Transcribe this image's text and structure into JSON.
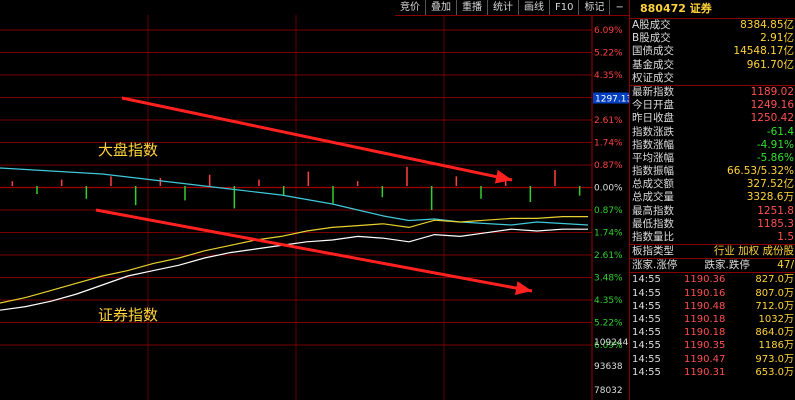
{
  "toolbar": {
    "items": [
      "竞价",
      "叠加",
      "重播",
      "统计",
      "画线",
      "F10",
      "标记",
      "−",
      "⊟"
    ]
  },
  "panel": {
    "code_title": "880472 证券",
    "stats": [
      {
        "label": "A股成交",
        "value": "8384.85亿"
      },
      {
        "label": "B股成交",
        "value": "2.91亿"
      },
      {
        "label": "国债成交",
        "value": "14548.17亿"
      },
      {
        "label": "基金成交",
        "value": "961.70亿"
      },
      {
        "label": "权证成交",
        "value": ""
      }
    ],
    "index_stats": [
      {
        "label": "最新指数",
        "value": "1189.02"
      },
      {
        "label": "今日开盘",
        "value": "1249.16"
      },
      {
        "label": "昨日收盘",
        "value": "1250.42"
      },
      {
        "label": "指数涨跌",
        "value": "-61.4"
      },
      {
        "label": "指数涨幅",
        "value": "-4.91%"
      },
      {
        "label": "平均涨幅",
        "value": "-5.86%"
      },
      {
        "label": "指数振幅",
        "value": "66.53/5.32%"
      },
      {
        "label": "总成交额",
        "value": "327.52亿"
      },
      {
        "label": "总成交量",
        "value": "3328.6万"
      },
      {
        "label": "最高指数",
        "value": "1251.8"
      },
      {
        "label": "最低指数",
        "value": "1185.3"
      },
      {
        "label": "指数量比",
        "value": "1.5"
      }
    ],
    "board": {
      "label": "板指类型",
      "value": "行业 加权 成份股"
    },
    "trade_header": {
      "left": "涨家.涨停",
      "mid": "跌家.跌停",
      "right": "47/"
    },
    "trades": [
      {
        "time": "14:55",
        "price": "1190.36",
        "vol": "827.0万"
      },
      {
        "time": "14:55",
        "price": "1190.16",
        "vol": "807.0万"
      },
      {
        "time": "14:55",
        "price": "1190.48",
        "vol": "712.0万"
      },
      {
        "time": "14:55",
        "price": "1190.18",
        "vol": "1032万"
      },
      {
        "time": "14:55",
        "price": "1190.18",
        "vol": "864.0万"
      },
      {
        "time": "14:55",
        "price": "1190.35",
        "vol": "1186万"
      },
      {
        "time": "14:55",
        "price": "1190.47",
        "vol": "973.0万"
      },
      {
        "time": "14:55",
        "price": "1190.31",
        "vol": "653.0万"
      }
    ]
  },
  "colors": {
    "grid": "#a00000",
    "white_line": "#ffffff",
    "yellow_line": "#e8d030",
    "upper_blue_line": "#40c8d8",
    "bar_up": "#ff4040",
    "bar_down": "#30d030",
    "arrow": "#ff2020",
    "annotation": "#ffd33a",
    "zero_label_bg": "#0040c0"
  },
  "chart_data": [
    {
      "type": "line",
      "title": "",
      "annotation": "大盘指数",
      "series": [
        {
          "values": [
            0.6,
            0.55,
            0.5,
            0.45,
            0.4,
            0.3,
            0.2,
            0.1,
            0.0,
            -0.1,
            -0.2,
            -0.3,
            -0.45,
            -0.6,
            -0.8,
            -1.0,
            -1.15,
            -1.1,
            -1.2,
            -1.25,
            -1.3,
            -1.2,
            -1.25,
            -1.3
          ]
        }
      ],
      "y_tick_labels": [
        "6.09%",
        "5.22%",
        "4.35%",
        "3.48%",
        "2.61%",
        "1.74%",
        "0.87%",
        "0.00%",
        "0.87%",
        "1.74%",
        "2.61%",
        "3.48%",
        "4.35%",
        "5.22%",
        "6.09%"
      ],
      "value_label": "1297.13"
    },
    {
      "type": "line",
      "annotation": "证券指数",
      "series": [
        {
          "values": [
            6.9,
            6.7,
            6.4,
            6.0,
            5.5,
            5.0,
            4.7,
            4.4,
            4.0,
            3.7,
            3.5,
            3.3,
            3.1,
            3.0,
            2.8,
            2.9,
            3.1,
            2.7,
            2.8,
            2.6,
            2.4,
            2.5,
            2.4,
            2.4
          ]
        },
        {
          "values": [
            6.5,
            6.2,
            5.8,
            5.4,
            5.0,
            4.7,
            4.3,
            4.0,
            3.6,
            3.3,
            3.0,
            2.8,
            2.5,
            2.3,
            2.2,
            2.1,
            2.3,
            1.9,
            2.0,
            1.9,
            1.8,
            1.8,
            1.7,
            1.7
          ]
        }
      ]
    },
    {
      "type": "bar",
      "title": "",
      "y_tick_labels": [
        "109244",
        "93638",
        "78032"
      ],
      "values": [
        0.3,
        -0.5,
        0.4,
        -0.8,
        0.6,
        -1.2,
        0.5,
        -0.9,
        0.7,
        -1.4,
        0.4,
        -0.6,
        0.9,
        -1.1,
        0.3,
        -0.7,
        1.2,
        -1.5,
        0.6,
        -0.8,
        0.5,
        -1.0,
        1.0,
        -0.6
      ]
    }
  ]
}
